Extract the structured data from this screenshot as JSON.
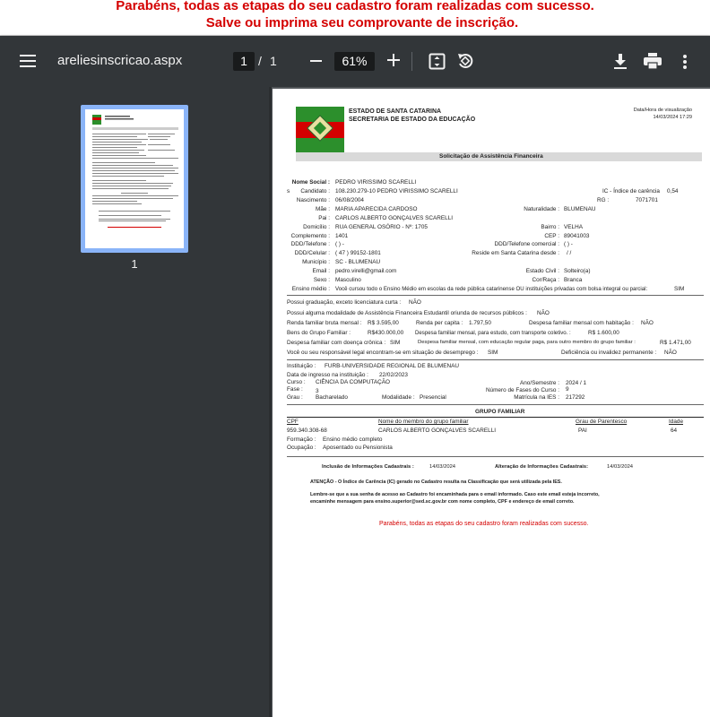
{
  "banner": {
    "line1": "Parabéns, todas as etapas do seu cadastro foram realizadas com sucesso.",
    "line2": "Salve ou imprima seu comprovante de inscrição."
  },
  "toolbar": {
    "file_title": "areliesinscricao.aspx",
    "page_current": "1",
    "page_sep": "/",
    "page_total": "1",
    "zoom": "61%"
  },
  "sidebar": {
    "thumbnail_number": "1"
  },
  "doc": {
    "org_line1": "ESTADO DE SANTA CATARINA",
    "org_line2": "SECRETARIA DE ESTADO DA EDUCAÇÃO",
    "datetime_label": "Data/Hora de visualização",
    "datetime_value": "14/03/2024 17:29",
    "section_title": "Solicitação de Assistência Financeira",
    "nome_social_label": "Nome Social :",
    "nome_social_value": "PEDRO VIRISSIMO SCARELLI",
    "s_mark": "s",
    "candidato_label": "Candidato :",
    "candidato_value": "108.230.279-10    PEDRO VIRISSIMO SCARELLI",
    "ic_label": "IC - Índice de carência",
    "ic_value": "0,54",
    "nascimento_label": "Nascimento :",
    "nascimento_value": "06/08/2004",
    "rg_label": "RG :",
    "rg_value": "7071701",
    "mae_label": "Mãe :",
    "mae_value": "MARIA APARECIDA CARDOSO",
    "naturalidade_label": "Naturalidade :",
    "naturalidade_value": "BLUMENAU",
    "pai_label": "Pai :",
    "pai_value": "CARLOS ALBERTO GONÇALVES SCARELLI",
    "domicilio_label": "Domicílio :",
    "domicilio_value": "RUA GENERAL OSÓRIO - Nº: 1705",
    "bairro_label": "Bairro :",
    "bairro_value": "VELHA",
    "complemento_label": "Complemento :",
    "complemento_value": "1401",
    "cep_label": "CEP :",
    "cep_value": "89041003",
    "ddd_tel_label": "DDD/Telefone :",
    "ddd_tel_value": "(      )      -",
    "ddd_com_label": "DDD/Telefone comercial :",
    "ddd_com_value": "(      )      -",
    "ddd_cel_label": "DDD/Celular :",
    "ddd_cel_value": "(   47   )    99152-1801",
    "reside_label": "Reside em Santa Catarina desde :",
    "reside_value": "/ /",
    "municipio_label": "Município :",
    "municipio_value": "SC    -    BLUMENAU",
    "email_label": "Email :",
    "email_value": "pedro.virelli@gmail.com",
    "estado_civil_label": "Estado Civil :",
    "estado_civil_value": "Solteiro(a)",
    "sexo_label": "Sexo :",
    "sexo_value": "Masculino",
    "cor_label": "Cor/Raça :",
    "cor_value": "Branca",
    "ensino_label": "Ensino médio :",
    "ensino_value": "Você cursou todo o Ensino Médio em escolas da rede pública catarinense OU instituições privadas com bolsa integral ou parcial:",
    "ensino_answer": "SIM",
    "pos_label": "Possui graduação, exceto licenciatura curta :",
    "pos_value": "NÃO",
    "mod_label": "Possui alguma modalidade de Assistência Financeira Estudantil oriunda de recursos públicos :",
    "mod_value": "NÃO",
    "renda_label": "Renda familiar bruta mensal :",
    "renda_value": "R$ 3.595,00",
    "percapita_label": "Renda per capita :",
    "percapita_value": "1.797,50",
    "hab_label": "Despesa familiar mensal com habitação :",
    "hab_value": "NÃO",
    "bens_label": "Bens do Grupo Familiar :",
    "bens_value": "R$430.000,00",
    "transp_label": "Despesa familiar mensal, para estudo, com transporte coletivo. :",
    "transp_value": "R$ 1.600,00",
    "doenca_label": "Despesa familiar com doença crônica :",
    "doenca_value": "SIM",
    "outro_label": "Despesa familiar mensal, com educação regular paga, para outro membro do grupo familiar :",
    "outro_value": "R$ 1.471,00",
    "desemp_label": "Você ou seu responsável legal encontram-se em situação de desemprego :",
    "desemp_value": "SIM",
    "defic_label": "Deficiência ou invalidez permanente :",
    "defic_value": "NÃO",
    "inst_label": "Instituição :",
    "inst_value": "FURB-UNIVERSIDADE REGIONAL DE BLUMENAU",
    "ingresso_label": "Data de ingresso na instituição :",
    "ingresso_value": "22/02/2023",
    "curso_label": "Curso :",
    "curso_value": "CIÊNCIA DA COMPUTAÇÃO",
    "anosem_label": "Ano/Semestre :",
    "anosem_value": "2024  /  1",
    "fase_label": "Fase :",
    "fase_value": "3",
    "nfases_label": "Número de Fases do Curso :",
    "nfases_value": "9",
    "grau_label": "Grau :",
    "grau_value": "Bacharelado",
    "modalidade_label": "Modalidade :",
    "modalidade_value": "Presencial",
    "matricula_label": "Matrícula na IES :",
    "matricula_value": "217292",
    "grupo_title": "GRUPO FAMILIAR",
    "grupo_headers": [
      "CPF",
      "Nome do membro do grupo familiar",
      "Grau de Parentesco",
      "Idade"
    ],
    "grupo_row": [
      "959.340.308-68",
      "CARLOS ALBERTO GONÇALVES SCARELLI",
      "PAI",
      "64"
    ],
    "formacao_label": "Formação :",
    "formacao_value": "Ensino médio completo",
    "ocupacao_label": "Ocupação :",
    "ocupacao_value": "Aposentado ou Pensionista",
    "inclusao_label": "Inclusão de Informações Cadastrais :",
    "inclusao_value": "14/03/2024",
    "alteracao_label": "Alteração de Informações Cadastrais:",
    "alteracao_value": "14/03/2024",
    "atencao": "ATENÇÃO - O Índice de Carência (IC) gerado no Cadastro resulta na Classificação que será utilizada pela IES.",
    "lembre1": "Lembre-se que a sua senha de acesso ao Cadastro foi encaminhada para o email informado. Caso este email esteja incorreto,",
    "lembre2": "encaminhe mensagem para ensino.superior@sed.sc.gov.br com nome completo, CPF e endereço de email correto.",
    "parabens": "Parabéns, todas as etapas do seu cadastro foram realizadas com sucesso."
  },
  "colors": {
    "toolbar": "#323639",
    "viewer_bg": "#525659",
    "alert_red": "#d40000",
    "thumb_border": "#8ab4f8"
  }
}
